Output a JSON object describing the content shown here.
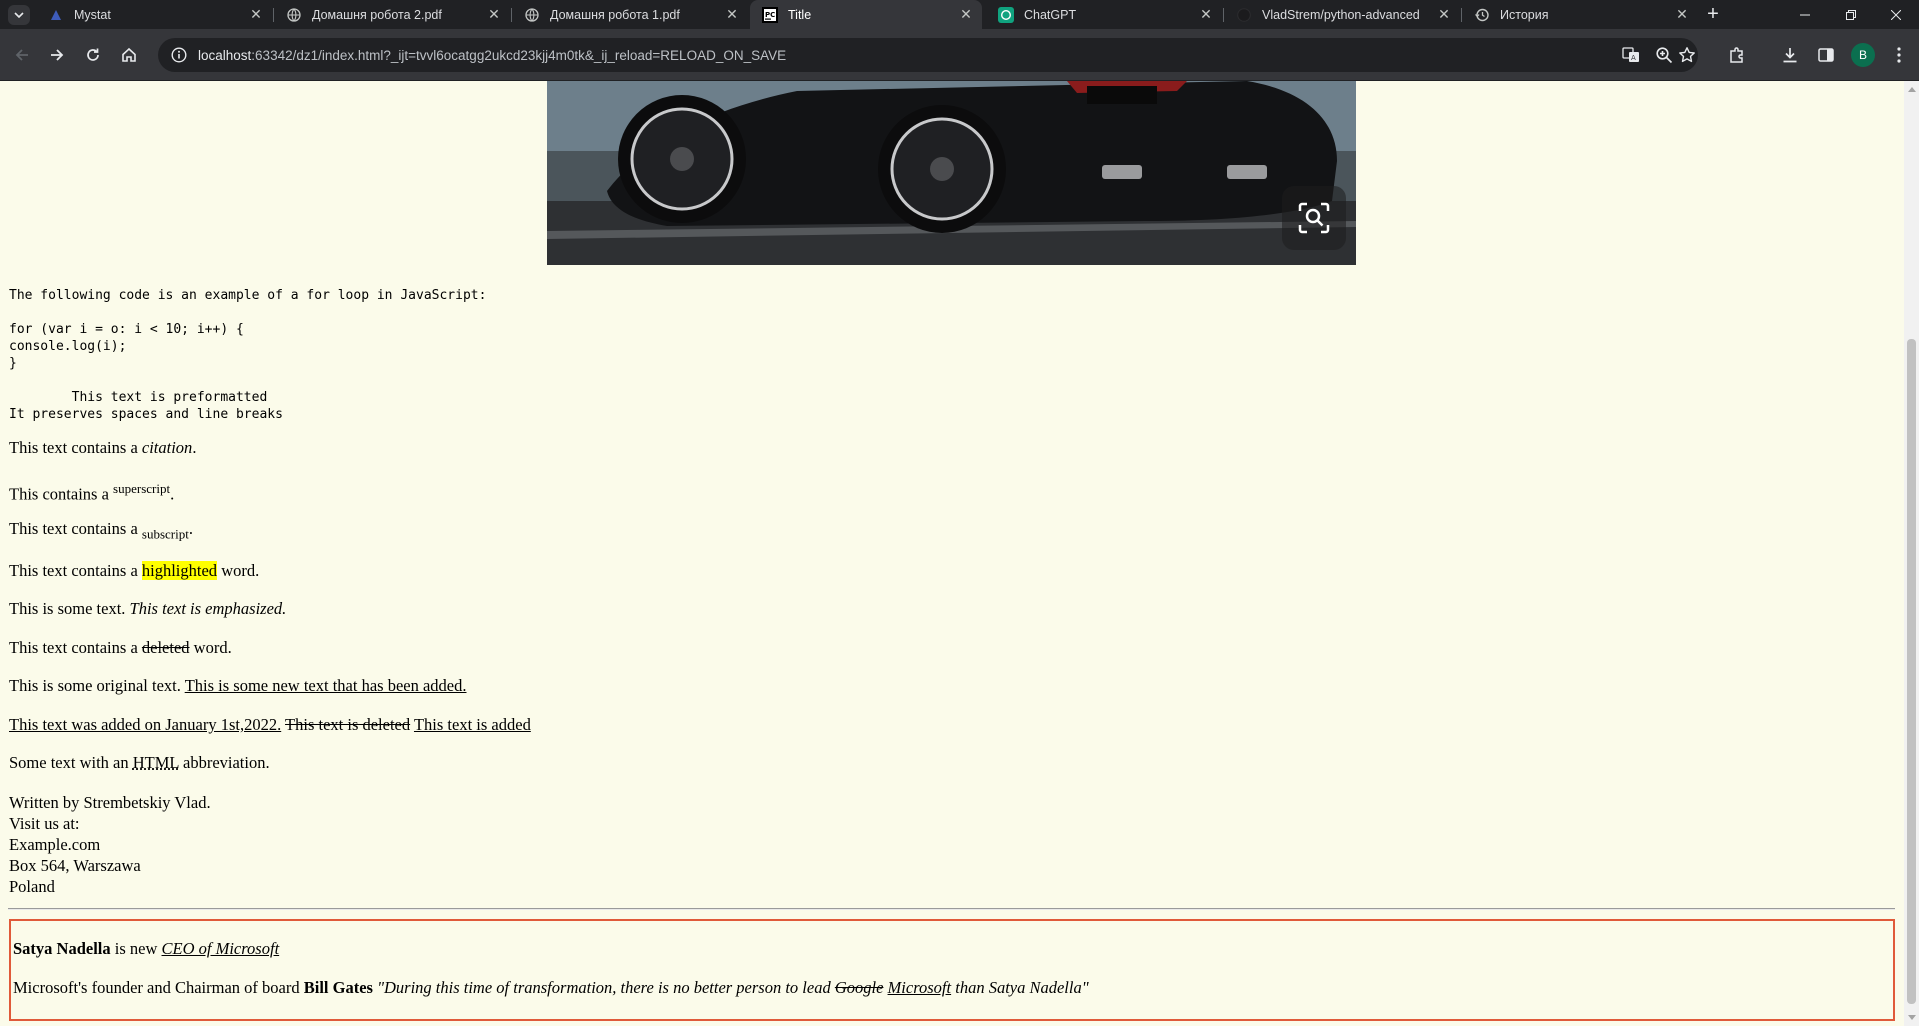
{
  "browser": {
    "tabs": [
      {
        "label": "Mystat",
        "icon": "mystat-icon"
      },
      {
        "label": "Домашня робота 2.pdf",
        "icon": "globe-icon"
      },
      {
        "label": "Домашня робота 1.pdf",
        "icon": "globe-icon"
      },
      {
        "label": "Title",
        "icon": "pycharm-icon",
        "active": true
      },
      {
        "label": "ChatGPT",
        "icon": "chatgpt-icon"
      },
      {
        "label": "VladStrem/python-advanced",
        "icon": "github-icon"
      },
      {
        "label": "История",
        "icon": "history-icon"
      }
    ],
    "url_host": "localhost",
    "url_rest": ":63342/dz1/index.html?_ijt=tvvl6ocatgg2ukcd23kjj4m0tk&_ij_reload=RELOAD_ON_SAVE",
    "profile_initial": "B",
    "profile_color": "#0b6f4f"
  },
  "page": {
    "code_intro": "The following code is an example of a for loop in JavaScript:",
    "code_lines": [
      "for (var i = o: i < 10; i++) {",
      "console.log(i);",
      "}"
    ],
    "pre_lines": [
      "        This text is preformatted",
      "It preserves spaces and line breaks"
    ],
    "cite": {
      "before": "This text contains a ",
      "cite": "citation",
      "after": "."
    },
    "sup": {
      "before": "This contains a ",
      "sup": "superscript",
      "after": "."
    },
    "sub": {
      "before": "This text contains a ",
      "sub": "subscript",
      "after": "."
    },
    "mark": {
      "before": "This text contains a ",
      "mark": "highlighted",
      "after": " word."
    },
    "em": {
      "before": "This is some text. ",
      "em": "This text is emphasized."
    },
    "del": {
      "before": "This text contains a ",
      "del": "deleted",
      "after": " word."
    },
    "ins": {
      "before": "This is some original text. ",
      "ins": "This is some new text that has been added."
    },
    "ins2": {
      "ins": "This text was added on January 1st,2022.",
      "del": "This text is deleted",
      "ins_b": "This text is added"
    },
    "abbr": {
      "before": "Some text with an ",
      "abbr": "HTML",
      "after": " abbreviation."
    },
    "address": [
      "Written by Strembetskiy Vlad.",
      "Visit us at:",
      "Example.com",
      "Box 564, Warszawa",
      "Poland"
    ],
    "quote": {
      "l1_name": "Satya Nadella",
      "l1_mid": " is new ",
      "l1_title": "CEO of Microsoft",
      "l2_before": "Microsoft's founder and Chairman of board ",
      "l2_name": "Bill Gates",
      "l2_q1": " \"During this time of transformation, there is no better person to lead ",
      "l2_del": "Google",
      "l2_ins": "Microsoft",
      "l2_q2": " than Satya Nadella\""
    }
  }
}
